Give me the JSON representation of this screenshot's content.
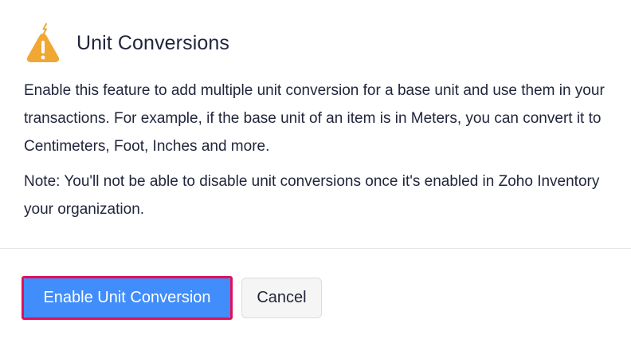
{
  "dialog": {
    "icon": "warning-icon",
    "title": "Unit Conversions",
    "description": "Enable this feature to add multiple unit conversion for a base unit and use them in your transactions. For example, if the base unit of an item is in Meters, you can convert it to Centimeters, Foot, Inches and more.",
    "note": "Note: You'll not be able to disable unit conversions once it's enabled in Zoho Inventory your organization."
  },
  "actions": {
    "enable_label": "Enable Unit Conversion",
    "cancel_label": "Cancel"
  },
  "colors": {
    "primary": "#408dfb",
    "highlight_border": "#e0105a",
    "warning_icon": "#f0a733",
    "text": "#21263c"
  }
}
